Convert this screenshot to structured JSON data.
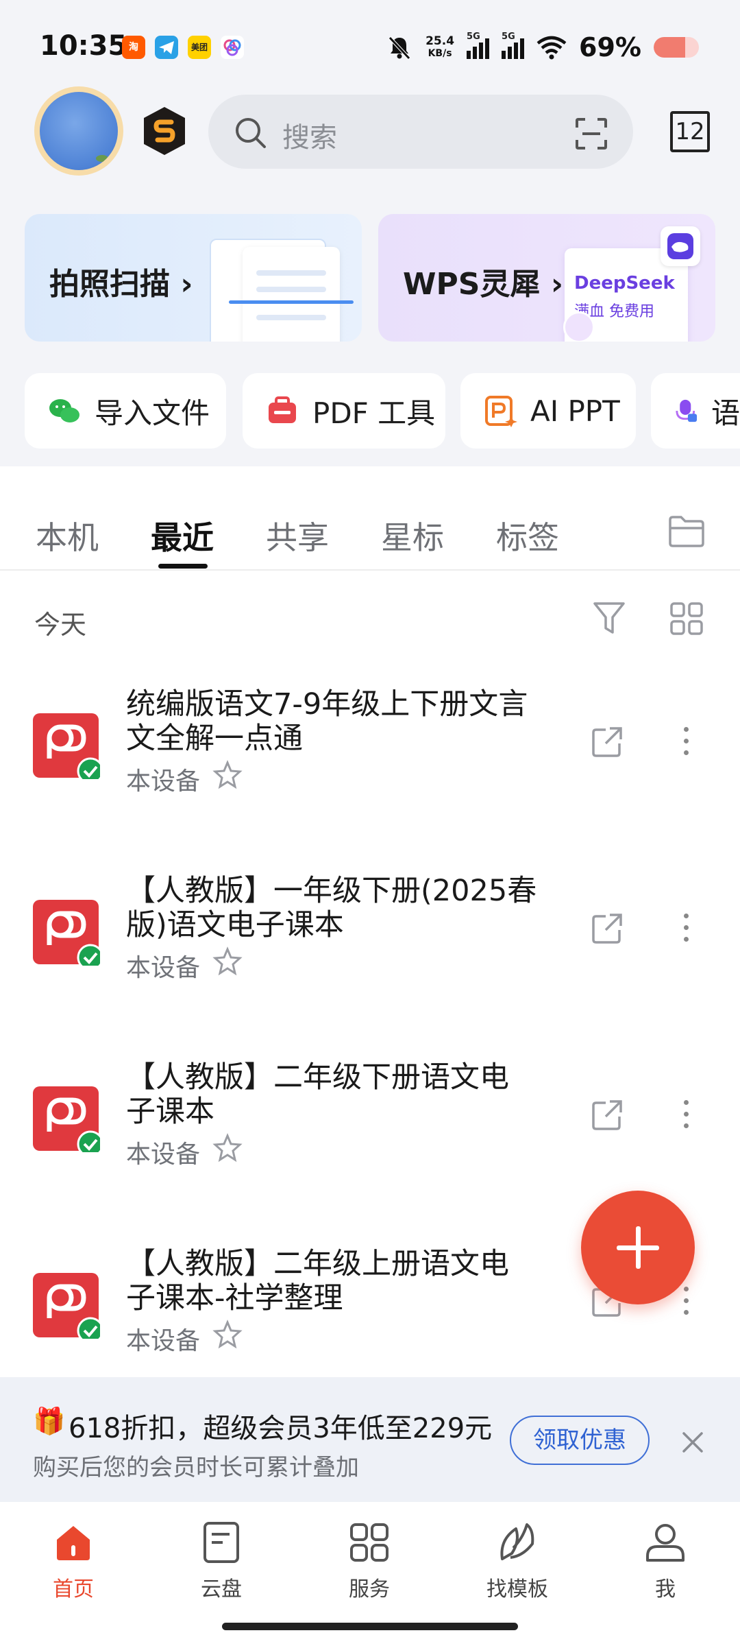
{
  "status": {
    "time": "10:35",
    "net_speed": "25.4",
    "net_unit": "KB/s",
    "sim1": "5G",
    "sim2": "5G",
    "battery_text": "69%",
    "battery_level": 0.69,
    "app_icons": [
      "taobao-icon",
      "telegram-icon",
      "meituan-icon",
      "community-icon"
    ],
    "meituan_label": "美团"
  },
  "header": {
    "search_placeholder": "搜索",
    "tab_count": "12"
  },
  "banners": [
    {
      "label": "拍照扫描",
      "arrow": "›"
    },
    {
      "label": "WPS灵犀",
      "arrow": "›",
      "promo_title": "DeepSeek",
      "promo_sub": "满血 免费用"
    }
  ],
  "quick_actions": [
    {
      "label": "导入文件",
      "icon": "wechat-icon"
    },
    {
      "label": "PDF 工具",
      "icon": "pdf-toolbox-icon"
    },
    {
      "label": "AI PPT",
      "icon": "ai-ppt-icon"
    },
    {
      "label": "语",
      "icon": "voice-icon"
    }
  ],
  "tabs": [
    {
      "label": "本机"
    },
    {
      "label": "最近"
    },
    {
      "label": "共享"
    },
    {
      "label": "星标"
    },
    {
      "label": "标签"
    }
  ],
  "active_tab": "最近",
  "section_title": "今天",
  "files": [
    {
      "name": "统编版语文7-9年级上下册文言文全解一点通",
      "location": "本设备",
      "type": "pdf",
      "synced": true
    },
    {
      "name": "【人教版】一年级下册(2025春版)语文电子课本",
      "location": "本设备",
      "type": "pdf",
      "synced": true
    },
    {
      "name": "【人教版】二年级下册语文电子课本",
      "location": "本设备",
      "type": "pdf",
      "synced": true
    },
    {
      "name": "【人教版】二年级上册语文电子课本-社学整理",
      "location": "本设备",
      "type": "pdf",
      "synced": true
    }
  ],
  "promo": {
    "title": "618折扣，超级会员3年低至229元",
    "subtitle": "购买后您的会员时长可累计叠加",
    "button": "领取优惠"
  },
  "bottom_nav": [
    {
      "label": "首页",
      "icon": "home-icon",
      "active": true
    },
    {
      "label": "云盘",
      "icon": "cloud-doc-icon",
      "active": false
    },
    {
      "label": "服务",
      "icon": "apps-grid-icon",
      "active": false
    },
    {
      "label": "找模板",
      "icon": "leaf-icon",
      "active": false
    },
    {
      "label": "我",
      "icon": "user-icon",
      "active": false
    }
  ],
  "colors": {
    "accent": "#e9482e",
    "pdf_red": "#e0393e",
    "sync_green": "#1aa250",
    "link_blue": "#2f62d2"
  }
}
